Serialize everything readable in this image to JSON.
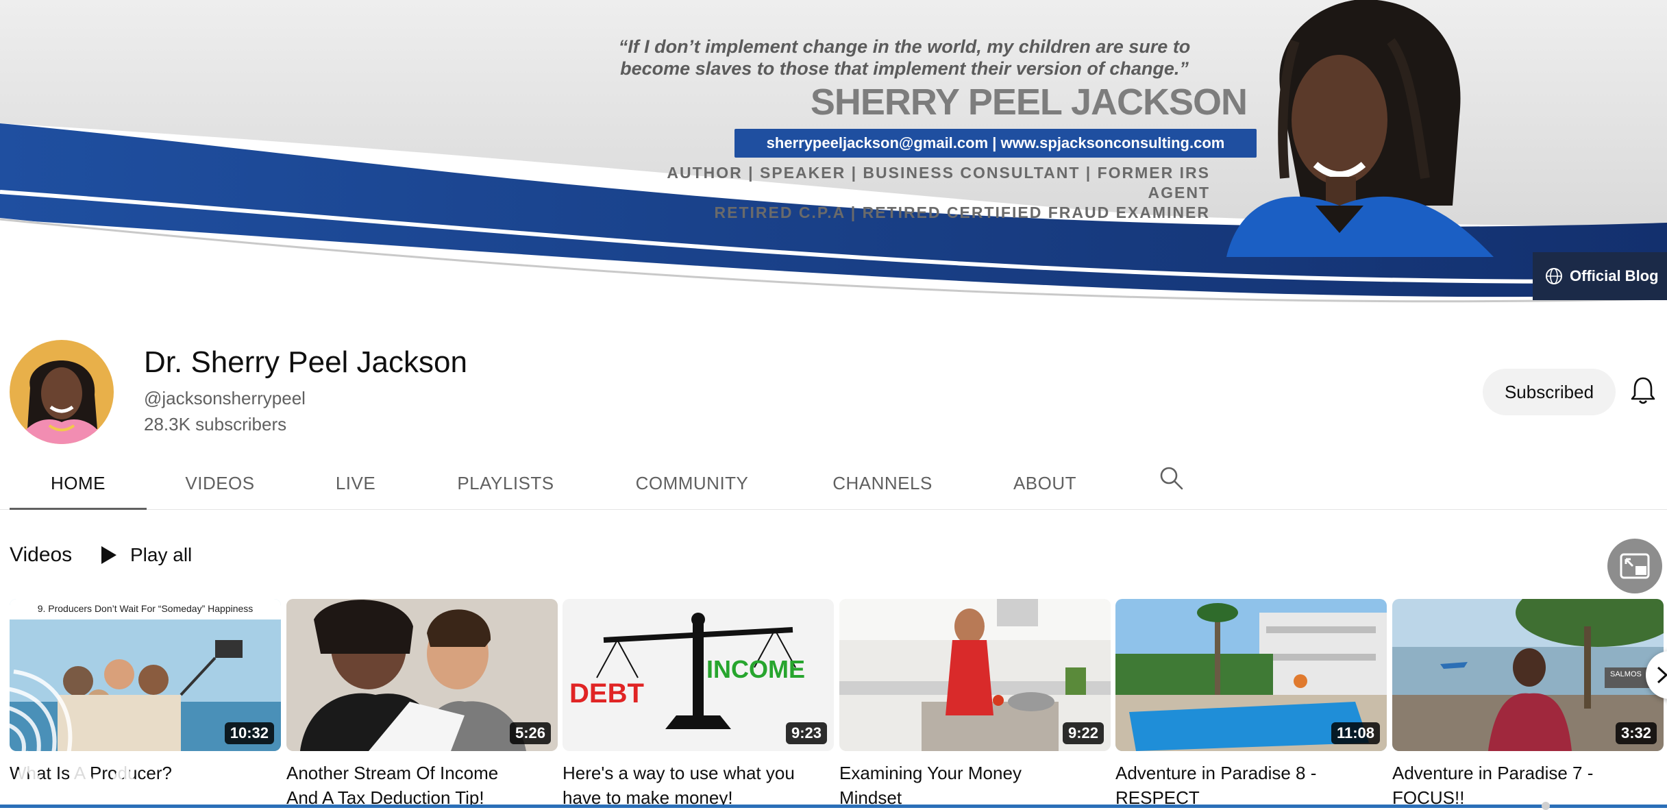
{
  "banner": {
    "quote_line1": "“If I don’t implement change in the world, my children are sure to",
    "quote_line2": "become slaves to those that implement their version of change.”",
    "name": "SHERRY PEEL JACKSON",
    "contact": "sherrypeeljackson@gmail.com | www.spjacksonconsulting.com",
    "roles_line1": "AUTHOR | SPEAKER | BUSINESS CONSULTANT | FORMER IRS AGENT",
    "roles_line2": "RETIRED C.P.A | RETIRED CERTIFIED FRAUD EXAMINER",
    "link_label": "Official Blog",
    "link_icon": "globe-icon",
    "accent_color": "#1f4fa0"
  },
  "channel": {
    "name": "Dr. Sherry Peel Jackson",
    "handle": "@jacksonsherrypeel",
    "subscribers": "28.3K subscribers",
    "subscribe_label": "Subscribed",
    "bell_icon": "bell-icon"
  },
  "tabs": [
    {
      "label": "HOME",
      "active": true
    },
    {
      "label": "VIDEOS",
      "active": false
    },
    {
      "label": "LIVE",
      "active": false
    },
    {
      "label": "PLAYLISTS",
      "active": false
    },
    {
      "label": "COMMUNITY",
      "active": false
    },
    {
      "label": "CHANNELS",
      "active": false
    },
    {
      "label": "ABOUT",
      "active": false
    }
  ],
  "section": {
    "title": "Videos",
    "play_all_label": "Play all"
  },
  "videos": [
    {
      "title_line1": "What Is A Producer?",
      "title_line2": "",
      "duration": "10:32",
      "thumb_caption": "9. Producers Don’t Wait For “Someday” Happiness"
    },
    {
      "title_line1": "Another Stream Of Income",
      "title_line2": "And A Tax Deduction Tip!",
      "duration": "5:26"
    },
    {
      "title_line1": "Here's a way to use what you",
      "title_line2": "have to make money!",
      "duration": "9:23",
      "thumb_left_word": "DEBT",
      "thumb_right_word": "INCOME"
    },
    {
      "title_line1": "Examining Your Money",
      "title_line2": "Mindset",
      "duration": "9:22"
    },
    {
      "title_line1": "Adventure in Paradise 8 -",
      "title_line2": "RESPECT",
      "duration": "11:08"
    },
    {
      "title_line1": "Adventure in Paradise 7 -",
      "title_line2": "FOCUS!!",
      "duration": "3:32",
      "thumb_sign": "SALMOS"
    }
  ]
}
